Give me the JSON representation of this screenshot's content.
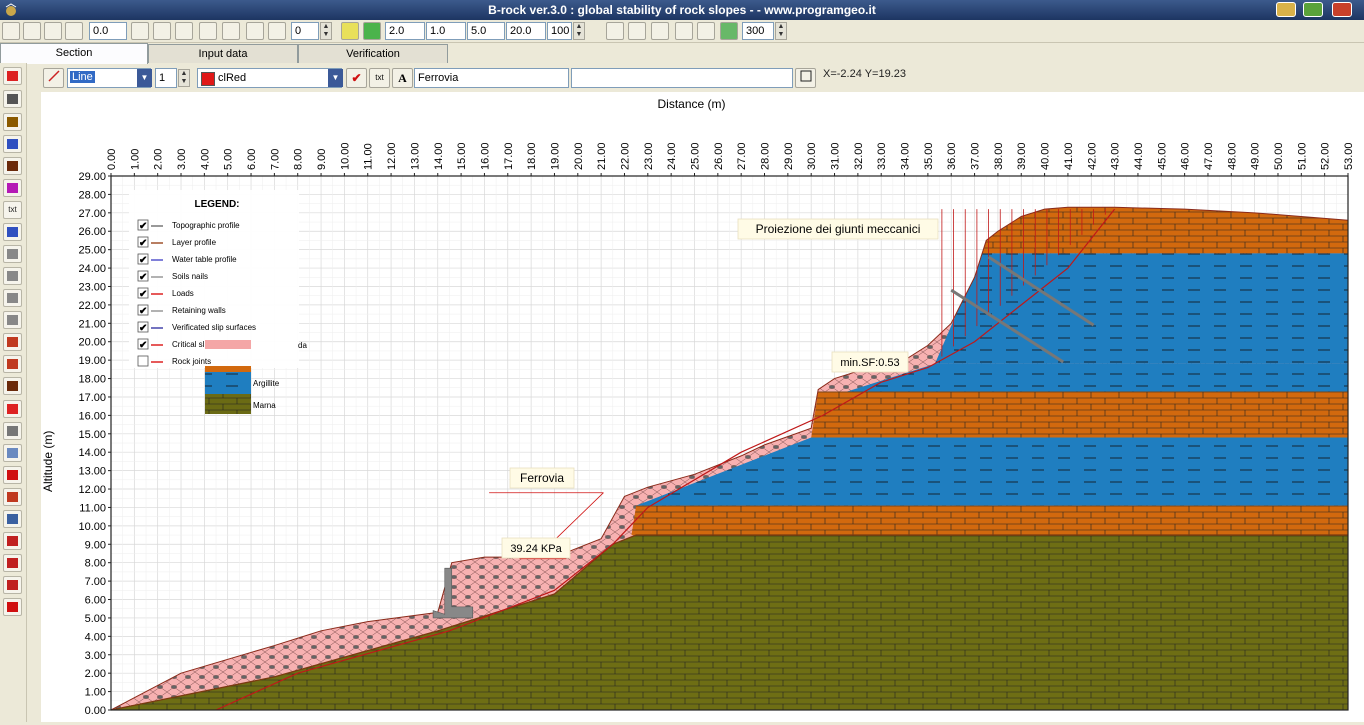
{
  "window": {
    "title": "B-rock ver.3.0 : global stability of rock slopes - - www.programgeo.it"
  },
  "toolbar": {
    "fields": [
      "0.0",
      "0",
      "2.0",
      "1.0",
      "5.0",
      "20.0",
      "100",
      "300"
    ],
    "icons": [
      "new-icon",
      "open-icon",
      "save-icon",
      "save-as-icon",
      "value-input",
      "align-right-icon",
      "align-left-icon",
      "cursor-icon",
      "undo-icon",
      "rectangle-icon",
      "line-icon",
      "axes-icon",
      "value-input",
      "zoom-icon",
      "grid-icon",
      "print-preview-icon",
      "print-icon",
      "table-icon",
      "chart-icon",
      "dxf-icon",
      "report-icon"
    ]
  },
  "tabs": [
    "Section",
    "Input data",
    "Verification"
  ],
  "lefttools": [
    "stop-icon",
    "slope-line-icon",
    "layer-icon",
    "water-table-icon",
    "column-icon",
    "nail-icon",
    "txt",
    "table-icon",
    "hline-icon",
    "vline-icon",
    "vline-icon",
    "vline-icon",
    "bars-icon",
    "bars-icon",
    "column-icon",
    "load-icon",
    "pencil-icon",
    "grid-icon",
    "check-icon",
    "wall-icon",
    "list-icon",
    "curve-icon",
    "axis-icon",
    "ruler-icon",
    "check-icon"
  ],
  "editbar": {
    "line_type": "Line",
    "width": "1",
    "color": "clRed",
    "text_value": "Ferrovia",
    "text2": "",
    "txt_button": "txt",
    "font_button": "A",
    "coords": "X=-2.24 Y=19.23"
  },
  "chart": {
    "xlabel": "Distance (m)",
    "ylabel": "Altitude (m)",
    "x_ticks": [
      "0.00",
      "1.00",
      "2.00",
      "3.00",
      "4.00",
      "5.00",
      "6.00",
      "7.00",
      "8.00",
      "9.00",
      "10.00",
      "11.00",
      "12.00",
      "13.00",
      "14.00",
      "15.00",
      "16.00",
      "17.00",
      "18.00",
      "19.00",
      "20.00",
      "21.00",
      "22.00",
      "23.00",
      "24.00",
      "25.00",
      "26.00",
      "27.00",
      "28.00",
      "29.00",
      "30.00",
      "31.00",
      "32.00",
      "33.00",
      "34.00",
      "35.00",
      "36.00",
      "37.00",
      "38.00",
      "39.00",
      "40.00",
      "41.00",
      "42.00",
      "43.00",
      "44.00",
      "45.00",
      "46.00",
      "47.00",
      "48.00",
      "49.00",
      "50.00",
      "51.00",
      "52.00",
      "53.00"
    ],
    "y_ticks": [
      "0.00",
      "1.00",
      "2.00",
      "3.00",
      "4.00",
      "5.00",
      "6.00",
      "7.00",
      "8.00",
      "9.00",
      "10.00",
      "11.00",
      "12.00",
      "13.00",
      "14.00",
      "15.00",
      "16.00",
      "17.00",
      "18.00",
      "19.00",
      "20.00",
      "21.00",
      "22.00",
      "23.00",
      "24.00",
      "25.00",
      "26.00",
      "27.00",
      "28.00",
      "29.00"
    ],
    "legend": {
      "title": "LEGEND:",
      "items": [
        {
          "label": "Topographic profile",
          "checked": true,
          "color": "#777777"
        },
        {
          "label": "Layer profile",
          "checked": true,
          "color": "#a0522d"
        },
        {
          "label": "Water table profile",
          "checked": true,
          "color": "#5555cc"
        },
        {
          "label": "Soils nails",
          "checked": true,
          "color": "#999999"
        },
        {
          "label": "Loads",
          "checked": true,
          "color": "#dd2222"
        },
        {
          "label": "Retaining walls",
          "checked": true,
          "color": "#999999"
        },
        {
          "label": "Verificated slip surfaces",
          "checked": true,
          "color": "#4444aa"
        },
        {
          "label": "Critical slip surface",
          "checked": true,
          "color": "#dd2222"
        },
        {
          "label": "Rock joints",
          "checked": false,
          "color": "#dd2222"
        }
      ],
      "materials": [
        {
          "label": "da",
          "color": "#f4a6a6"
        },
        {
          "label": "Argillite",
          "color": "#1f7ec0"
        },
        {
          "label": "Marna",
          "color": "#6b6b14"
        }
      ]
    },
    "annotations": {
      "joints_label": "Proiezione dei giunti meccanici",
      "sf_label": "min.SF:0.53",
      "rail_label": "Ferrovia",
      "load_label": "39.24 KPa"
    },
    "colors": {
      "marna": "#6e6e14",
      "orange": "#d2690e",
      "blue": "#1f7ec0",
      "pink": "#f7b1b1",
      "grid": "#d8d8d8"
    }
  },
  "chart_data": {
    "type": "area",
    "title": "",
    "xlabel": "Distance (m)",
    "ylabel": "Altitude (m)",
    "xlim": [
      0,
      53
    ],
    "ylim": [
      0,
      29
    ],
    "grid": true,
    "legend_position": "top-left",
    "series": [
      {
        "name": "Topographic profile",
        "x": [
          0,
          3,
          7,
          9,
          11,
          14,
          14.6,
          16,
          19,
          21,
          22,
          23,
          25,
          27,
          28,
          30,
          30.3,
          31,
          33,
          34,
          35,
          36,
          37,
          37.5,
          38,
          39,
          40,
          41,
          43,
          46,
          49,
          53
        ],
        "y": [
          0,
          2,
          3.5,
          4.3,
          4.8,
          5.3,
          8,
          8.3,
          8.3,
          9.3,
          11.6,
          12.1,
          12.8,
          13.8,
          14.4,
          15.3,
          17.4,
          18,
          18.8,
          19,
          19.8,
          21,
          23.5,
          25.5,
          26,
          26.8,
          27.2,
          27.3,
          27.3,
          27.2,
          27,
          26.6
        ]
      },
      {
        "name": "Critical slip surface",
        "x": [
          4.5,
          8,
          14.5,
          19,
          21.5,
          23,
          27,
          30.5,
          33,
          35,
          37,
          39,
          41,
          43
        ],
        "y": [
          0,
          2,
          4.3,
          6.5,
          9,
          11,
          14,
          16,
          17.8,
          18.6,
          20,
          22,
          24,
          27.2
        ]
      },
      {
        "name": "Marna top",
        "x": [
          0,
          7,
          14,
          19,
          21.5,
          22.5,
          53
        ],
        "y": [
          0,
          1.8,
          4.3,
          6.3,
          9,
          9.5,
          9.5
        ]
      },
      {
        "name": "Loads",
        "x": [
          17.5,
          19.5
        ],
        "y": [
          8.3,
          8.3
        ],
        "value_label": "39.24 KPa"
      }
    ]
  }
}
